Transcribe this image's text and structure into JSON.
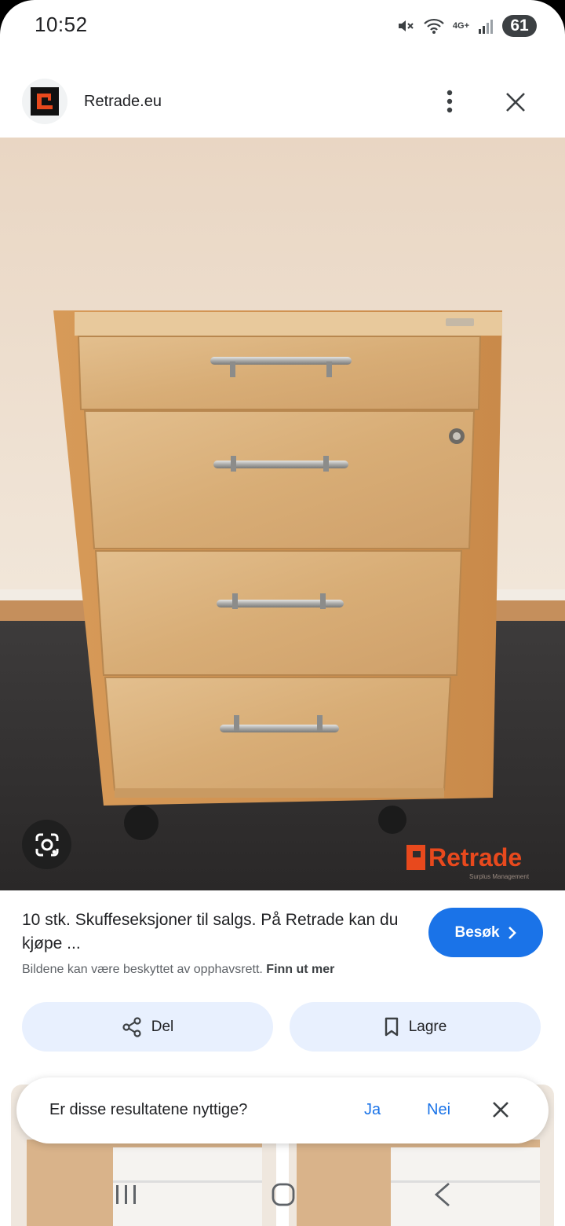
{
  "status_bar": {
    "time": "10:52",
    "network": "4G+",
    "battery": "61"
  },
  "header": {
    "site_name": "Retrade.eu",
    "logo_icon": "retrade-logo-icon",
    "brand_color": "#e8491d"
  },
  "image": {
    "watermark_brand": "Retrade",
    "watermark_tagline": "Surplus Management"
  },
  "result": {
    "title": "10 stk. Skuffeseksjoner til salgs. På Retrade kan du kjøpe ...",
    "copyright_text": "Bildene kan være beskyttet av opphavsrett.",
    "learn_more": "Finn ut mer",
    "visit_label": "Besøk"
  },
  "actions": {
    "share_label": "Del",
    "save_label": "Lagre"
  },
  "feedback": {
    "question": "Er disse resultatene nyttige?",
    "yes": "Ja",
    "no": "Nei"
  },
  "colors": {
    "accent": "#1a73e8",
    "chip_bg": "#e8f0fe"
  }
}
